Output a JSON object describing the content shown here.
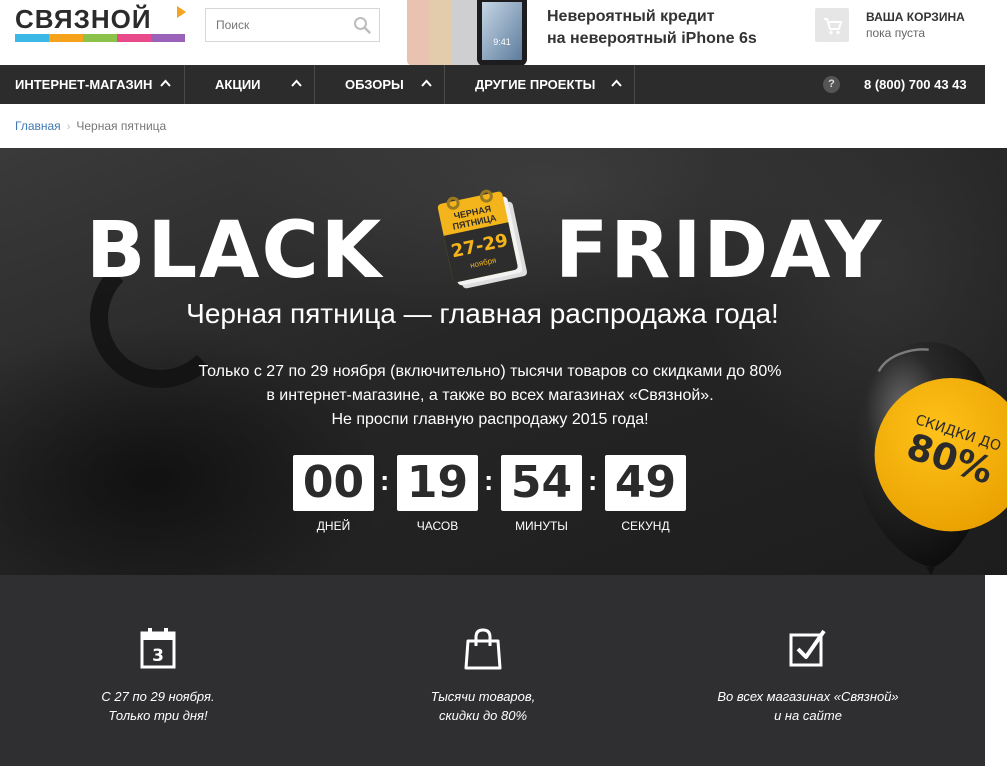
{
  "header": {
    "logo_text": "СВЯЗНОЙ",
    "logo_colors": [
      "#3cb8e6",
      "#f7a21b",
      "#8bc34a",
      "#e94b8a",
      "#9a62b8"
    ],
    "search": {
      "placeholder": "Поиск"
    },
    "promo": {
      "line1": "Невероятный кредит",
      "line2": "на невероятный iPhone 6s"
    },
    "cart": {
      "title": "ВАША КОРЗИНА",
      "status": "пока пуста"
    }
  },
  "nav": {
    "items": [
      {
        "label": "ИНТЕРНЕТ-МАГАЗИН"
      },
      {
        "label": "АКЦИИ"
      },
      {
        "label": "ОБЗОРЫ"
      },
      {
        "label": "ДРУГИЕ ПРОЕКТЫ"
      }
    ],
    "help": "?",
    "phone": "8 (800) 700 43 43"
  },
  "breadcrumb": {
    "home": "Главная",
    "current": "Черная пятница"
  },
  "hero": {
    "title_left": "BLACK",
    "title_right": "FRIDAY",
    "calendar": {
      "line1": "ЧЕРНАЯ",
      "line2": "ПЯТНИЦА",
      "dates": "27-29",
      "month": "ноября"
    },
    "subtitle": "Черная пятница — главная распродажа года!",
    "desc_lines": [
      "Только с 27 по 29 ноября (включительно) тысячи товаров со скидками до 80%",
      "в интернет-магазине, а также во всех магазинах «Связной».",
      "Не проспи главную распродажу 2015 года!"
    ],
    "countdown": [
      {
        "value": "00",
        "label": "ДНЕЙ"
      },
      {
        "value": "19",
        "label": "ЧАСОВ"
      },
      {
        "value": "54",
        "label": "МИНУТЫ"
      },
      {
        "value": "49",
        "label": "СЕКУНД"
      }
    ],
    "countdown_separator": ":",
    "balloon": {
      "line1": "СКИДКИ ДО",
      "line2": "80%"
    }
  },
  "features": [
    {
      "icon": "calendar-icon",
      "calendar_day": "3",
      "lines": [
        "С 27 по 29 ноября.",
        "Только три дня!"
      ]
    },
    {
      "icon": "shopping-bag-icon",
      "lines": [
        "Тысячи товаров,",
        "скидки до 80%"
      ]
    },
    {
      "icon": "checkbox-icon",
      "lines": [
        "Во всех магазинах «Связной»",
        "и на сайте"
      ]
    }
  ]
}
